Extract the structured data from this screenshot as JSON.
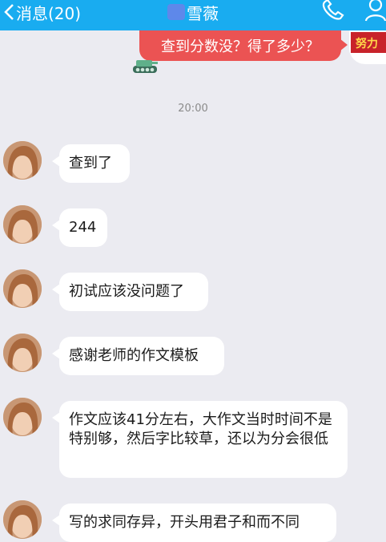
{
  "header": {
    "back_label": "消息(20)",
    "title": "雪薇",
    "call_icon": "phone-icon",
    "profile_icon": "person-icon",
    "bg_color": "#19acf0"
  },
  "sent_message": {
    "text": "查到分数没？得了多少？",
    "bubble_color": "#eb5353",
    "avatar_text": "努力"
  },
  "timestamp": "20:00",
  "messages": [
    {
      "text": "查到了"
    },
    {
      "text": "244"
    },
    {
      "text": "初试应该没问题了"
    },
    {
      "text": "感谢老师的作文模板"
    },
    {
      "text": "作文应该41分左右，大作文当时时间不是特别够，然后字比较草，还以为分会很低"
    },
    {
      "text": "写的求同存异，开头用君子和而不同"
    }
  ]
}
